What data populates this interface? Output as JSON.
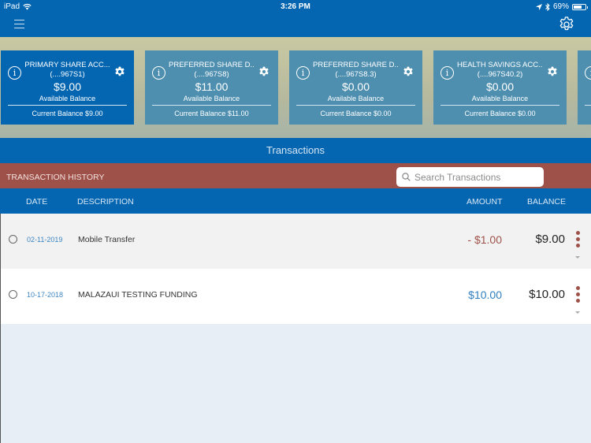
{
  "status_bar": {
    "device": "iPad",
    "time": "3:26 PM",
    "battery": "69%",
    "battery_level": 0.69
  },
  "navbar": {
    "menu_icon": "hamburger-icon",
    "settings_icon": "gear-icon"
  },
  "accounts": [
    {
      "name": "PRIMARY SHARE ACC...",
      "number": "(....967S1)",
      "available": "$9.00",
      "available_label": "Available Balance",
      "current": "Current Balance $9.00",
      "active": true
    },
    {
      "name": "PREFERRED SHARE D...",
      "number": "(....967S8)",
      "available": "$11.00",
      "available_label": "Available Balance",
      "current": "Current Balance $11.00",
      "active": false
    },
    {
      "name": "PREFERRED SHARE D...",
      "number": "(....967S8.3)",
      "available": "$0.00",
      "available_label": "Available Balance",
      "current": "Current Balance $0.00",
      "active": false
    },
    {
      "name": "HEALTH SAVINGS ACC...",
      "number": "(....967S40.2)",
      "available": "$0.00",
      "available_label": "Available Balance",
      "current": "Current Balance $0.00",
      "active": false
    }
  ],
  "transactions": {
    "title": "Transactions",
    "history_label": "TRANSACTION HISTORY",
    "search_placeholder": "Search Transactions",
    "search_value": "",
    "columns": {
      "date": "DATE",
      "description": "DESCRIPTION",
      "amount": "AMOUNT",
      "balance": "BALANCE"
    },
    "rows": [
      {
        "date": "02-11-2019",
        "description": "Mobile Transfer",
        "amount": "- $1.00",
        "balance": "$9.00",
        "type": "debit"
      },
      {
        "date": "10-17-2018",
        "description": "MALAZAUI TESTING FUNDING",
        "amount": "$10.00",
        "balance": "$10.00",
        "type": "credit"
      }
    ]
  },
  "colors": {
    "primary": "#0466b1",
    "history_bar": "#9e5149",
    "debit": "#9e5149",
    "credit": "#2f7fbf",
    "card_inactive": "#4e8fb0"
  }
}
